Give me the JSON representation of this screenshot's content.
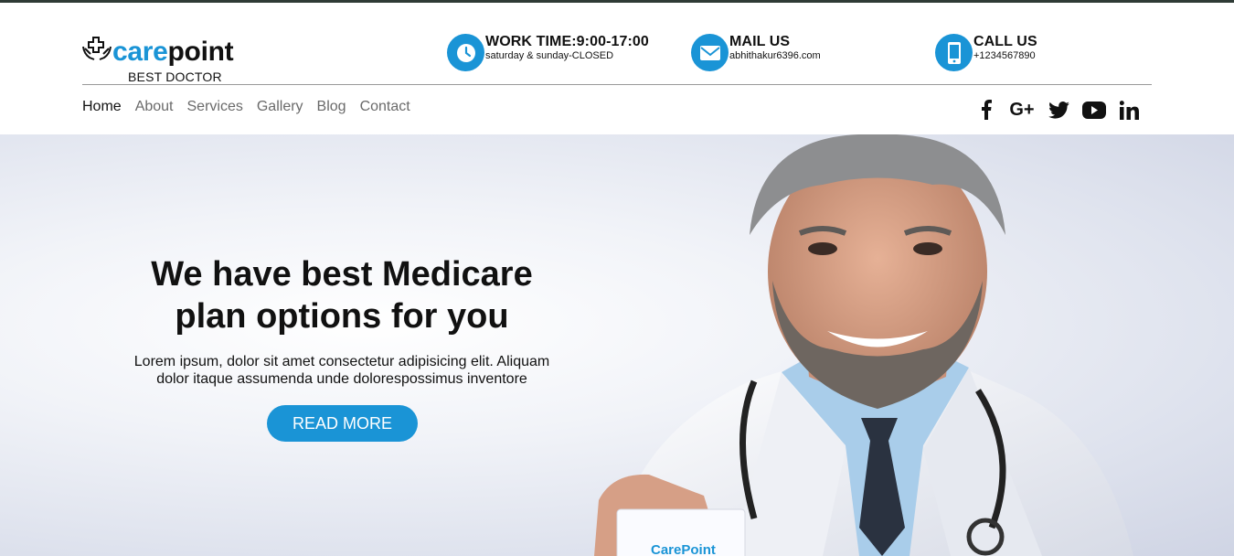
{
  "brand": {
    "name_part1": "care",
    "name_part2": "point",
    "tagline": "BEST DOCTOR"
  },
  "contact": {
    "work": {
      "title": "WORK TIME:9:00-17:00",
      "sub": "saturday & sunday-CLOSED",
      "icon": "clock-icon"
    },
    "mail": {
      "title": "MAIL US",
      "sub": "abhithakur6396.com",
      "icon": "envelope-icon"
    },
    "call": {
      "title": "CALL US",
      "sub": "+1234567890",
      "icon": "phone-icon"
    }
  },
  "nav": [
    "Home",
    "About",
    "Services",
    "Gallery",
    "Blog",
    "Contact"
  ],
  "social": [
    "facebook-icon",
    "google-plus-icon",
    "twitter-icon",
    "youtube-icon",
    "linkedin-icon"
  ],
  "hero": {
    "title_line1": "We have best Medicare",
    "title_line2": "plan options for you",
    "text_line1": "Lorem ipsum, dolor sit amet consectetur adipisicing elit. Aliquam",
    "text_line2": "dolor itaque assumenda unde dolorespossimus inventore",
    "button": "READ MORE",
    "card_text": "CarePoint"
  },
  "colors": {
    "accent": "#1a94d6",
    "text": "#111111",
    "nav_inactive": "#6a6a6a"
  }
}
